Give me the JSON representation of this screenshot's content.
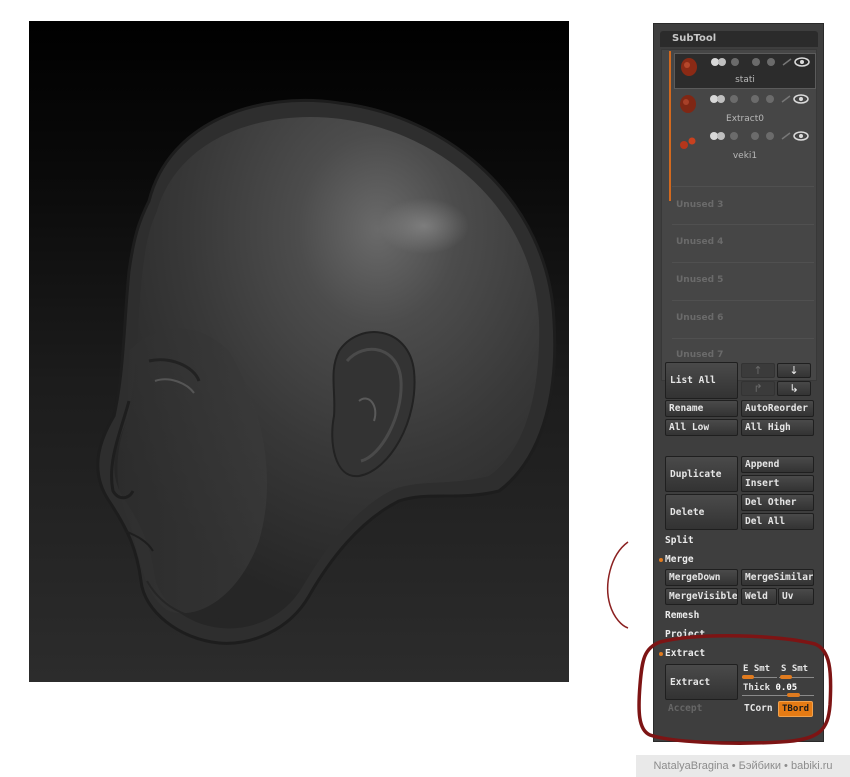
{
  "panel": {
    "title": "SubTool",
    "subtools": [
      {
        "name": "stati",
        "active": true
      },
      {
        "name": "Extract0",
        "active": false
      },
      {
        "name": "veki1",
        "active": false
      }
    ],
    "unused": [
      "Unused 3",
      "Unused 4",
      "Unused 5",
      "Unused 6",
      "Unused 7"
    ],
    "buttons": {
      "list_all": "List All",
      "rename": "Rename",
      "auto_reorder": "AutoReorder",
      "all_low": "All Low",
      "all_high": "All High",
      "duplicate": "Duplicate",
      "append": "Append",
      "insert": "Insert",
      "delete": "Delete",
      "del_other": "Del Other",
      "del_all": "Del All",
      "merge_down": "MergeDown",
      "merge_similar": "MergeSimilar",
      "merge_visible": "MergeVisible",
      "weld": "Weld",
      "uv": "Uv",
      "extract": "Extract",
      "accept": "Accept",
      "tcorn": "TCorn",
      "tbord": "TBord"
    },
    "sections": {
      "split": "Split",
      "merge": "Merge",
      "remesh": "Remesh",
      "project": "Project",
      "extract": "Extract"
    },
    "sliders": {
      "e_smt_label": "E Smt",
      "s_smt_label": "S Smt",
      "thick_label": "Thick",
      "thick_value": "0.05"
    },
    "accent_color": "#e07b1f"
  },
  "watermark": "NatalyaBragina • Бэйбики • babiki.ru"
}
